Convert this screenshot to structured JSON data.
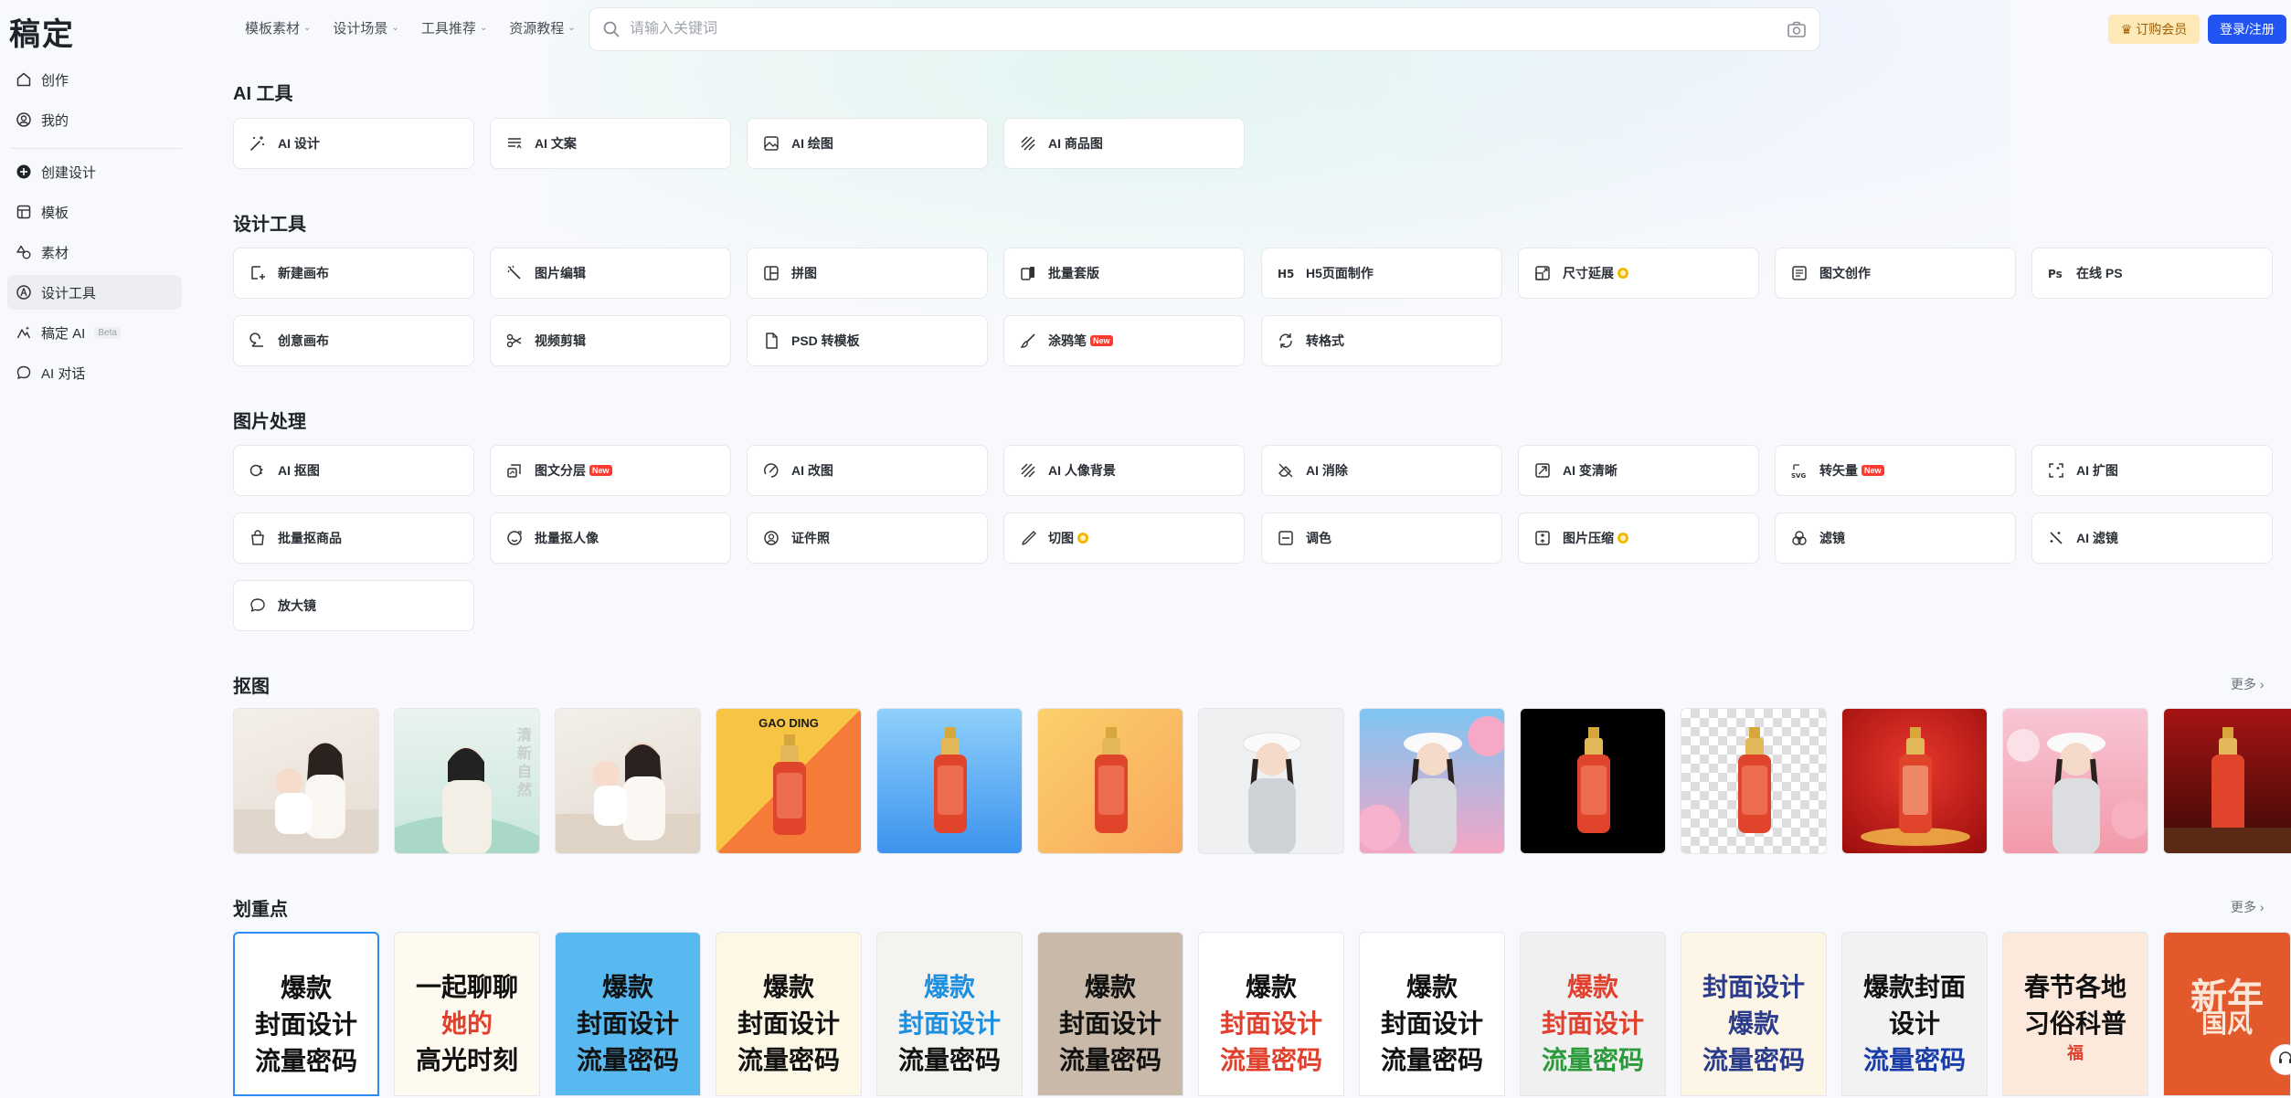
{
  "app": {
    "logo": "稿定"
  },
  "nav": [
    {
      "label": "模板素材"
    },
    {
      "label": "设计场景"
    },
    {
      "label": "工具推荐"
    },
    {
      "label": "资源教程"
    }
  ],
  "search": {
    "placeholder": "请输入关键词",
    "icon": "search-icon",
    "camera_icon": "camera-icon"
  },
  "header": {
    "vip_label": "订购会员",
    "login_label": "登录/注册"
  },
  "sidebar": {
    "items": [
      {
        "label": "创作",
        "icon": "home-icon"
      },
      {
        "label": "我的",
        "icon": "user-icon"
      },
      {
        "label": "创建设计",
        "icon": "plus-circle-icon"
      },
      {
        "label": "模板",
        "icon": "template-icon"
      },
      {
        "label": "素材",
        "icon": "shapes-icon"
      },
      {
        "label": "设计工具",
        "icon": "compass-icon"
      },
      {
        "label": "稿定 AI",
        "icon": "ai-icon",
        "badge": "Beta"
      },
      {
        "label": "AI 对话",
        "icon": "chat-icon"
      }
    ]
  },
  "sections": {
    "ai_tools": {
      "title": "AI 工具",
      "items": [
        {
          "label": "AI 设计",
          "icon": "magic-wand-icon"
        },
        {
          "label": "AI 文案",
          "icon": "text-lines-icon"
        },
        {
          "label": "AI 绘图",
          "icon": "image-icon"
        },
        {
          "label": "AI 商品图",
          "icon": "hatch-icon"
        }
      ]
    },
    "design_tools": {
      "title": "设计工具",
      "items": [
        {
          "label": "新建画布",
          "icon": "new-canvas-icon"
        },
        {
          "label": "图片编辑",
          "icon": "wand-edit-icon"
        },
        {
          "label": "拼图",
          "icon": "layout-icon"
        },
        {
          "label": "批量套版",
          "icon": "batch-icon"
        },
        {
          "label": "H5页面制作",
          "icon": "h5-icon"
        },
        {
          "label": "尺寸延展",
          "icon": "resize-icon",
          "vip": true
        },
        {
          "label": "图文创作",
          "icon": "doc-icon"
        },
        {
          "label": "在线 PS",
          "icon": "ps-icon"
        },
        {
          "label": "创意画布",
          "icon": "creative-icon"
        },
        {
          "label": "视频剪辑",
          "icon": "scissors-icon"
        },
        {
          "label": "PSD 转模板",
          "icon": "psd-file-icon"
        },
        {
          "label": "涂鸦笔",
          "icon": "brush-icon",
          "badge": "New"
        },
        {
          "label": "转格式",
          "icon": "convert-icon"
        }
      ]
    },
    "image_processing": {
      "title": "图片处理",
      "items": [
        {
          "label": "AI 抠图",
          "icon": "cutout-icon"
        },
        {
          "label": "图文分层",
          "icon": "layers-icon",
          "badge": "New"
        },
        {
          "label": "AI 改图",
          "icon": "ai-edit-icon"
        },
        {
          "label": "AI 人像背景",
          "icon": "portrait-bg-icon"
        },
        {
          "label": "AI 消除",
          "icon": "eraser-icon"
        },
        {
          "label": "AI 变清晰",
          "icon": "sharpen-icon"
        },
        {
          "label": "转矢量",
          "icon": "svg-icon",
          "badge": "New"
        },
        {
          "label": "AI 扩图",
          "icon": "expand-icon"
        },
        {
          "label": "批量抠商品",
          "icon": "bag-icon"
        },
        {
          "label": "批量抠人像",
          "icon": "face-icon"
        },
        {
          "label": "证件照",
          "icon": "id-photo-icon"
        },
        {
          "label": "切图",
          "icon": "knife-icon",
          "vip": true
        },
        {
          "label": "调色",
          "icon": "palette-icon"
        },
        {
          "label": "图片压缩",
          "icon": "compress-icon",
          "vip": true
        },
        {
          "label": "滤镜",
          "icon": "filter-icon"
        },
        {
          "label": "AI 滤镜",
          "icon": "ai-filter-icon"
        },
        {
          "label": "放大镜",
          "icon": "magnifier-icon"
        }
      ]
    },
    "cutout": {
      "title": "抠图",
      "more": "更多",
      "thumb_texts": {
        "gao_ding": "GAO DING",
        "vertical": "清新自然"
      }
    },
    "highlight": {
      "title": "划重点",
      "more": "更多",
      "posters": [
        {
          "lines": [
            "爆款",
            "封面设计",
            "流量密码"
          ]
        },
        {
          "lines": [
            "一起聊聊",
            "她的",
            "高光时刻"
          ]
        },
        {
          "lines": [
            "爆款",
            "封面设计",
            "流量密码"
          ]
        },
        {
          "lines": [
            "爆款",
            "封面设计",
            "流量密码"
          ]
        },
        {
          "lines": [
            "爆款",
            "封面设计",
            "流量密码"
          ]
        },
        {
          "lines": [
            "爆款",
            "封面设计",
            "流量密码"
          ]
        },
        {
          "lines": [
            "爆款",
            "封面设计",
            "流量密码"
          ]
        },
        {
          "lines": [
            "爆款",
            "封面设计",
            "流量密码"
          ]
        },
        {
          "lines": [
            "爆款",
            "封面设计",
            "流量密码"
          ]
        },
        {
          "lines": [
            "封面设计",
            "爆款",
            "流量密码"
          ]
        },
        {
          "lines": [
            "爆款封面",
            "设计",
            "流量密码"
          ]
        },
        {
          "lines": [
            "春节各地",
            "习俗科普",
            "福"
          ]
        },
        {
          "lines": [
            "新年",
            "国风"
          ]
        }
      ]
    }
  }
}
